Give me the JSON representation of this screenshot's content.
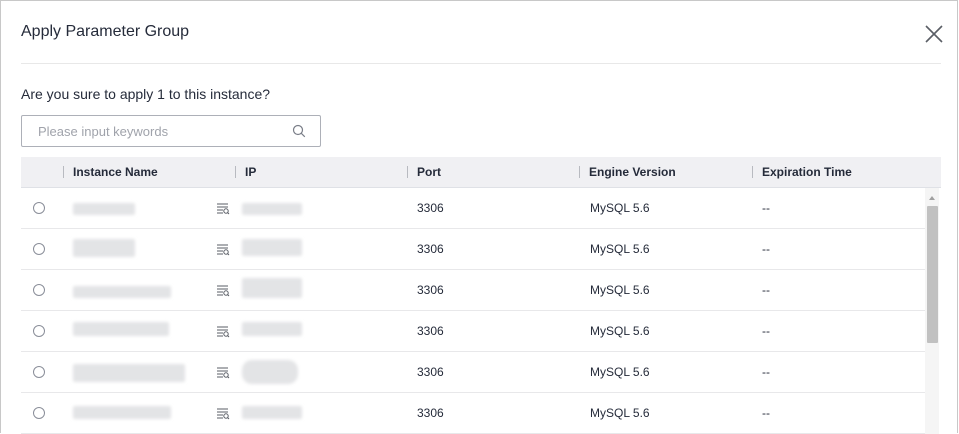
{
  "dialog": {
    "title": "Apply Parameter Group",
    "question": "Are you sure to apply 1 to this instance?",
    "search_placeholder": "Please input keywords"
  },
  "table": {
    "columns": [
      "Instance Name",
      "IP",
      "Port",
      "Engine Version",
      "Expiration Time"
    ],
    "rows": [
      {
        "port": "3306",
        "engine": "MySQL 5.6",
        "expiration": "--"
      },
      {
        "port": "3306",
        "engine": "MySQL 5.6",
        "expiration": "--"
      },
      {
        "port": "3306",
        "engine": "MySQL 5.6",
        "expiration": "--"
      },
      {
        "port": "3306",
        "engine": "MySQL 5.6",
        "expiration": "--"
      },
      {
        "port": "3306",
        "engine": "MySQL 5.6",
        "expiration": "--"
      },
      {
        "port": "3306",
        "engine": "MySQL 5.6",
        "expiration": "--"
      }
    ]
  },
  "icons": {
    "close": "close-icon",
    "search": "search-icon",
    "detail": "detail-list-icon"
  }
}
